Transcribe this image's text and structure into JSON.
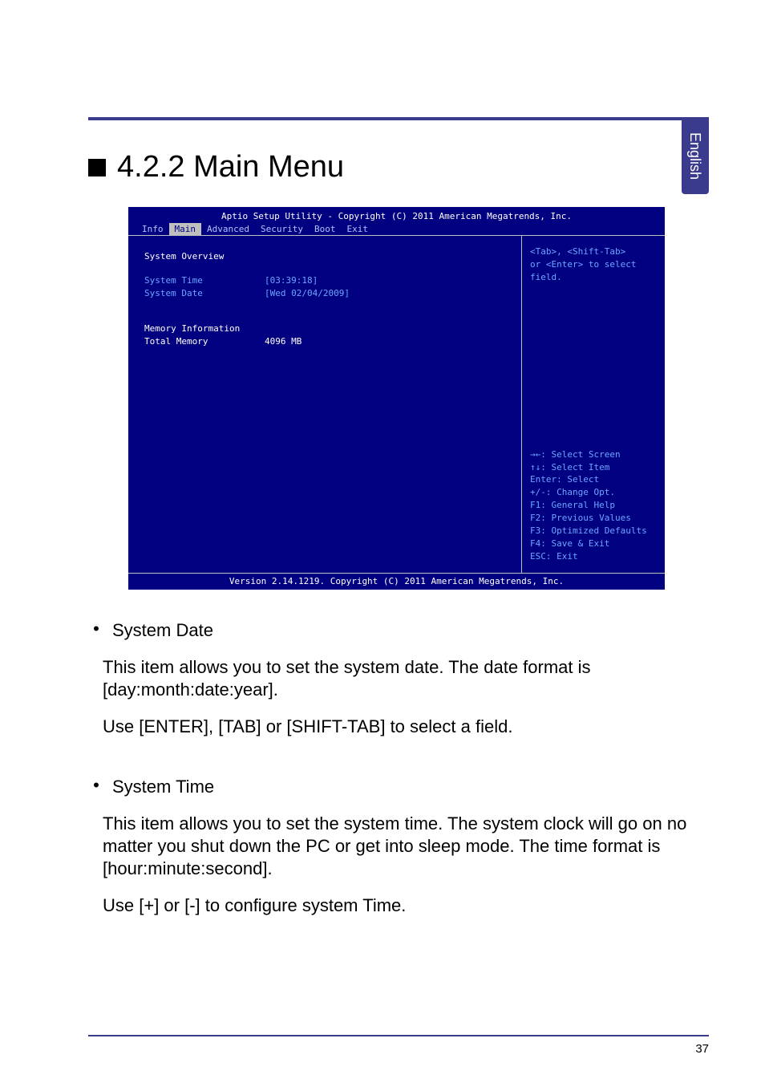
{
  "side_tab": "English",
  "heading": "4.2.2 Main Menu",
  "bios": {
    "topline": "Aptio Setup Utility - Copyright (C) 2011 American Megatrends, Inc.",
    "tabs": [
      "Info",
      "Main",
      "Advanced",
      "Security",
      "Boot",
      "Exit"
    ],
    "active_tab": "Main",
    "overview_title": "System Overview",
    "sys_time_label": "System Time",
    "sys_time_val": "[03:39:18]",
    "sys_date_label": "System Date",
    "sys_date_val": "[Wed 02/04/2009]",
    "mem_info_title": "Memory Information",
    "total_mem_label": "Total Memory",
    "total_mem_val": "4096 MB",
    "help_top": "<Tab>, <Shift-Tab>\nor <Enter> to select\nfield.",
    "help_keys": "→←: Select Screen\n↑↓: Select Item\nEnter: Select\n+/-: Change Opt.\nF1: General Help\nF2: Previous Values\nF3: Optimized Defaults\nF4: Save & Exit\nESC: Exit",
    "footer": "Version 2.14.1219. Copyright (C) 2011 American Megatrends, Inc."
  },
  "items": [
    {
      "title": "System Date",
      "para1": "This item allows you to set the system date. The date format is [day:month:date:year].",
      "para2": "Use [ENTER], [TAB] or [SHIFT-TAB] to select a field."
    },
    {
      "title": "System Time",
      "para1": "This item allows you to set the system time. The system clock will go on no matter you shut down the PC or get into sleep mode. The time format is [hour:minute:second].",
      "para2": "Use [+] or [-] to configure system Time."
    }
  ],
  "page_number": "37",
  "chart_data": {
    "type": "table",
    "rows": [
      {
        "field": "System Time",
        "value": "[03:39:18]"
      },
      {
        "field": "System Date",
        "value": "[Wed 02/04/2009]"
      },
      {
        "field": "Total Memory",
        "value": "4096 MB"
      }
    ]
  }
}
